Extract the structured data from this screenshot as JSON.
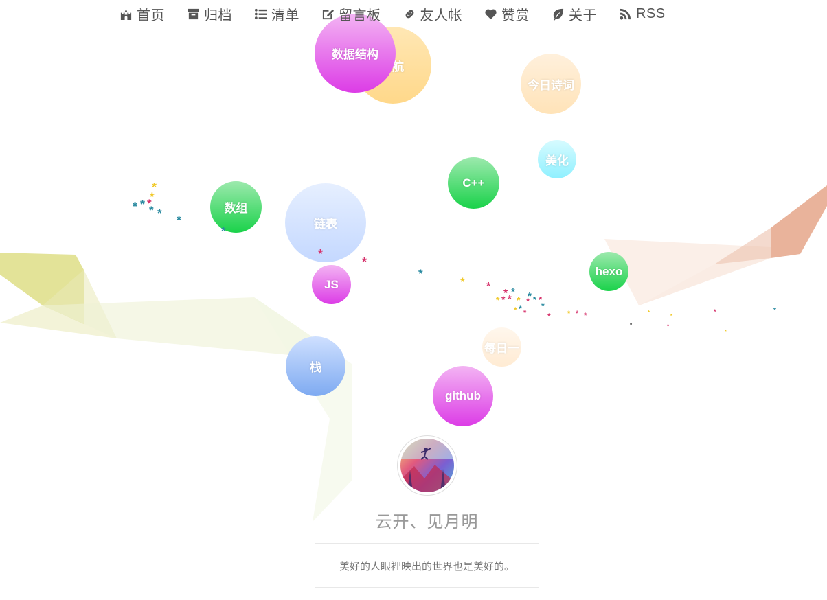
{
  "nav": {
    "items": [
      {
        "label": "首页",
        "icon": "castle-icon"
      },
      {
        "label": "归档",
        "icon": "archive-icon"
      },
      {
        "label": "清单",
        "icon": "list-icon"
      },
      {
        "label": "留言板",
        "icon": "edit-icon"
      },
      {
        "label": "友人帐",
        "icon": "link-icon"
      },
      {
        "label": "赞赏",
        "icon": "heart-icon"
      },
      {
        "label": "关于",
        "icon": "leaf-icon"
      },
      {
        "label": "RSS",
        "icon": "rss-icon"
      }
    ]
  },
  "tags": {
    "t1": "航",
    "t2": "数据结构",
    "t3": "今日诗词",
    "t4": "美化",
    "t5": "C++",
    "t6": "数组",
    "t7": "链表",
    "t8": "hexo",
    "t9": "JS",
    "t10": "每日一",
    "t11": "栈",
    "t12": "github"
  },
  "profile": {
    "title": "云开、见月明",
    "motto": "美好的人眼裡映出的世界也是美好的。"
  },
  "colors": {
    "star_teal": "#2a8aa0",
    "star_pink": "#d6336c",
    "star_yellow": "#f0c929",
    "nav_text": "#555555"
  }
}
